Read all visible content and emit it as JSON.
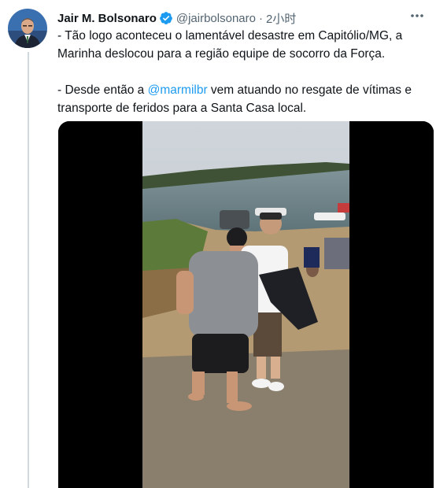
{
  "tweet": {
    "author": {
      "name": "Jair M. Bolsonaro",
      "handle": "@jairbolsonaro",
      "verified_icon": "verified-badge-icon",
      "avatar": "avatar-photo"
    },
    "separator": "·",
    "time": "2小时",
    "more_icon": "more-icon",
    "paragraph1": "- Tão logo aconteceu o lamentável desastre em Capitólio/MG, a Marinha deslocou para a região equipe de socorro da Força.",
    "paragraph2_before": "- Desde então a ",
    "mention": "@marmilbr",
    "paragraph2_after": " vem atuando no resgate de vítimas e transporte de feridos para a Santa Casa local.",
    "colors": {
      "text": "#0f1419",
      "secondary": "#536471",
      "link": "#1d9bf0",
      "thread_line": "#cfd9de"
    }
  },
  "media": {
    "type": "video",
    "content": "video-frame"
  }
}
